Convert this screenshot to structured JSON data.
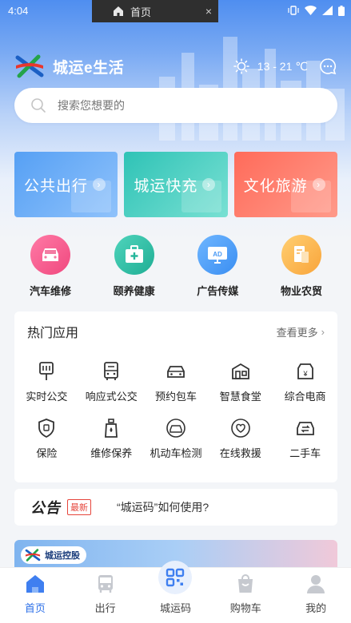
{
  "status_bar": {
    "time": "4:04"
  },
  "overlay_tab": {
    "label": "首页",
    "close": "×"
  },
  "header": {
    "app_title": "城运e生活",
    "weather": "13 - 21 ℃"
  },
  "search": {
    "placeholder": "搜索您想要的"
  },
  "cards": [
    {
      "label": "公共出行",
      "color": "#56a0f4"
    },
    {
      "label": "城运快充",
      "color": "#2fc3b6"
    },
    {
      "label": "文化旅游",
      "color": "#ff6b5a"
    }
  ],
  "services": [
    {
      "label": "汽车维修",
      "icon": "car-repair-icon"
    },
    {
      "label": "颐养健康",
      "icon": "medical-kit-icon"
    },
    {
      "label": "广告传媒",
      "icon": "ad-screen-icon"
    },
    {
      "label": "物业农贸",
      "icon": "property-icon"
    }
  ],
  "hot_apps": {
    "title": "热门应用",
    "more": "查看更多",
    "items": [
      {
        "label": "实时公交",
        "icon": "bus-stop-sign-icon"
      },
      {
        "label": "响应式公交",
        "icon": "bus-icon"
      },
      {
        "label": "预约包车",
        "icon": "car-front-icon"
      },
      {
        "label": "智慧食堂",
        "icon": "canteen-icon"
      },
      {
        "label": "综合电商",
        "icon": "shop-icon"
      },
      {
        "label": "保险",
        "icon": "shield-icon"
      },
      {
        "label": "维修保养",
        "icon": "oil-bottle-icon"
      },
      {
        "label": "机动车检测",
        "icon": "car-inspection-icon"
      },
      {
        "label": "在线救援",
        "icon": "rescue-heart-icon"
      },
      {
        "label": "二手车",
        "icon": "used-car-icon"
      }
    ]
  },
  "notice": {
    "title": "公告",
    "badge": "最新",
    "text": "“城运码”如何使用?"
  },
  "promo": {
    "logo_text": "城运控股"
  },
  "tabbar": [
    {
      "label": "首页",
      "icon": "home-icon",
      "active": true
    },
    {
      "label": "出行",
      "icon": "bus-icon",
      "active": false
    },
    {
      "label": "城运码",
      "icon": "qr-code-icon",
      "active": false
    },
    {
      "label": "购物车",
      "icon": "shopping-bag-icon",
      "active": false
    },
    {
      "label": "我的",
      "icon": "user-icon",
      "active": false
    }
  ],
  "colors": {
    "accent": "#2b6fe8",
    "header_gradient_top": "#4f8ef0"
  }
}
